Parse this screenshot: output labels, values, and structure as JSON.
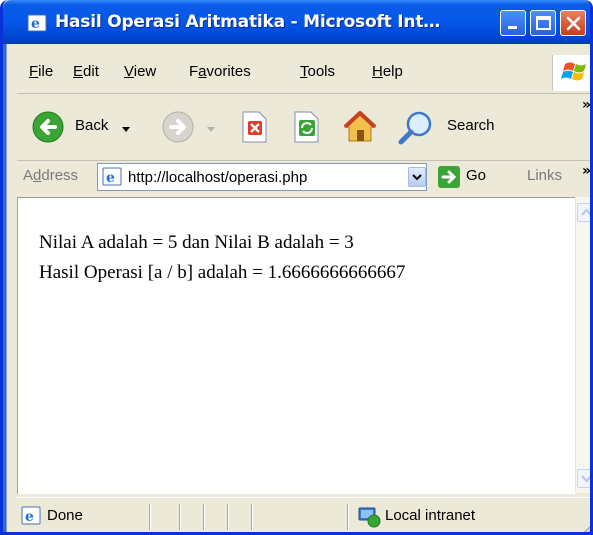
{
  "window": {
    "title": "Hasil Operasi Aritmatika - Microsoft Int…"
  },
  "menu": {
    "items": [
      {
        "label": "File",
        "accel": "F",
        "rest": "ile"
      },
      {
        "label": "Edit",
        "accel": "E",
        "rest": "dit"
      },
      {
        "label": "View",
        "accel": "V",
        "rest": "iew"
      },
      {
        "label": "Favorites",
        "pre": "F",
        "accel": "a",
        "rest": "vorites"
      },
      {
        "label": "Tools",
        "accel": "T",
        "rest": "ools"
      },
      {
        "label": "Help",
        "accel": "H",
        "rest": "elp"
      }
    ]
  },
  "toolbar": {
    "back_label": "Back",
    "search_label": "Search",
    "more": "»"
  },
  "address": {
    "label_pre": "A",
    "label_accel": "d",
    "label_rest": "dress",
    "url": "http://localhost/operasi.php",
    "go_label": "Go",
    "links_label": "Links",
    "more": "»"
  },
  "page": {
    "line1": "Nilai A adalah = 5 dan Nilai B adalah = 3",
    "line2": "Hasil Operasi [a / b] adalah = 1.6666666666667"
  },
  "status": {
    "text": "Done",
    "zone": "Local intranet"
  },
  "colors": {
    "title_bar": "#0457e8",
    "close_button": "#c83c1d",
    "chrome": "#ece9d8"
  }
}
